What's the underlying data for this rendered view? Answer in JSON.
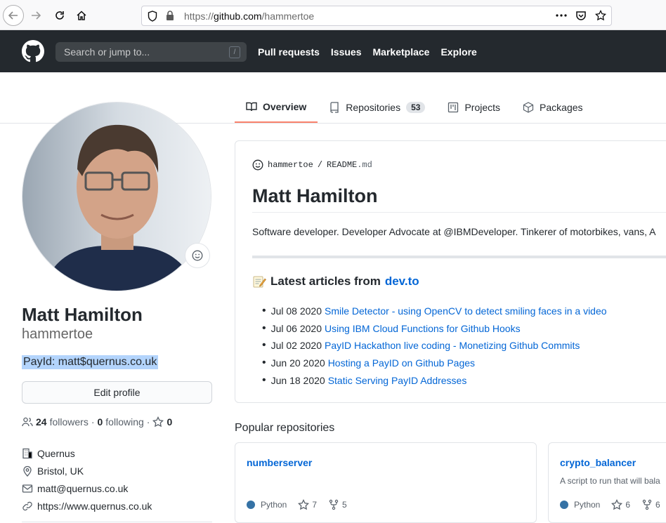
{
  "browser": {
    "url_prefix": "https://",
    "url_host": "github.com",
    "url_path": "/hammertoe"
  },
  "header": {
    "search_placeholder": "Search or jump to...",
    "search_shortcut": "/",
    "nav": [
      "Pull requests",
      "Issues",
      "Marketplace",
      "Explore"
    ]
  },
  "tabs": {
    "overview": "Overview",
    "repositories": "Repositories",
    "repositories_count": "53",
    "projects": "Projects",
    "packages": "Packages"
  },
  "profile": {
    "full_name": "Matt Hamilton",
    "username": "hammertoe",
    "bio": "PayId: matt$quernus.co.uk",
    "edit_label": "Edit profile",
    "followers_count": "24",
    "followers_label": "followers",
    "separator": "·",
    "following_count": "0",
    "following_label": "following",
    "stars_count": "0",
    "company": "Quernus",
    "location": "Bristol, UK",
    "email": "matt@quernus.co.uk",
    "website": "https://www.quernus.co.uk"
  },
  "readme": {
    "owner": "hammertoe",
    "slash": "/",
    "file": "README",
    "ext": ".md",
    "title": "Matt Hamilton",
    "description": "Software developer. Developer Advocate at @IBMDeveloper. Tinkerer of motorbikes, vans, A",
    "articles_heading": "Latest articles from",
    "articles_source": "dev.to",
    "articles": [
      {
        "date": "Jul 08 2020",
        "title": "Smile Detector - using OpenCV to detect smiling faces in a video"
      },
      {
        "date": "Jul 06 2020",
        "title": "Using IBM Cloud Functions for Github Hooks"
      },
      {
        "date": "Jul 02 2020",
        "title": "PayID Hackathon live coding - Monetizing Github Commits"
      },
      {
        "date": "Jun 20 2020",
        "title": "Hosting a PayID on Github Pages"
      },
      {
        "date": "Jun 18 2020",
        "title": "Static Serving PayID Addresses"
      }
    ]
  },
  "popular": {
    "heading": "Popular repositories",
    "repos": [
      {
        "name": "numberserver",
        "description": "",
        "language": "Python",
        "lang_color": "#3572A5",
        "stars": "7",
        "forks": "5"
      },
      {
        "name": "crypto_balancer",
        "description": "A script to run that will bala",
        "language": "Python",
        "lang_color": "#3572A5",
        "stars": "6",
        "forks": "6"
      }
    ]
  },
  "colors": {
    "header_bg": "#24292e",
    "link": "#0366d6",
    "tab_active_underline": "#f9826c",
    "selection": "#b3d4fc"
  }
}
